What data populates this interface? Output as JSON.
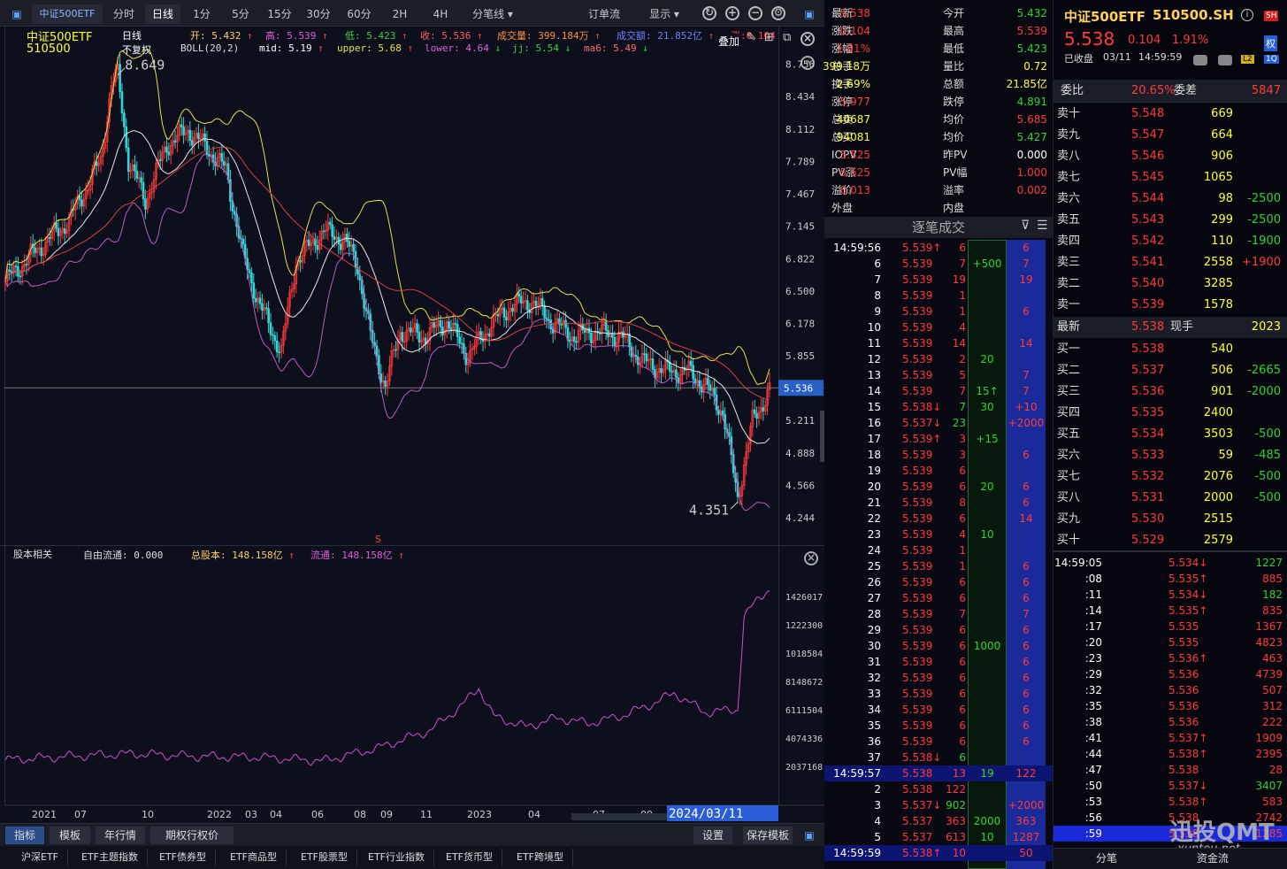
{
  "colors": {
    "up": "#ff3b3b",
    "down": "#2fd62f",
    "bg": "#0d0f1c",
    "ma_yellow": "#e5e04c",
    "ma_white": "#e8e8e8",
    "ma_red": "#d84040",
    "boll_lower": "#c05ac0"
  },
  "toolbar": {
    "security": "中证500ETF",
    "tabs": [
      "分时",
      "日线",
      "1分",
      "5分",
      "15分",
      "30分",
      "60分",
      "2H",
      "4H"
    ],
    "active_tab": "日线",
    "split": "分笔线",
    "order_flow": "订单流",
    "display": "显示"
  },
  "info_bar": {
    "name": "中证500ETF",
    "code": "510500",
    "period": "日线",
    "adjust": "不复权",
    "indicator": "BOLL(20,2)",
    "open_label": "开:",
    "open": "5.432",
    "high_label": "高:",
    "high": "5.539",
    "low_label": "低:",
    "low": "5.423",
    "close_label": "收:",
    "close": "5.536",
    "vol_label": "成交量:",
    "vol": "399.184万",
    "amt_label": "成交额:",
    "amt": "21.852亿",
    "chg_label": "涨:",
    "chg": "0.104",
    "overlay": "叠加",
    "mid_label": "mid:",
    "mid": "5.19",
    "upper_label": "upper:",
    "upper": "5.68",
    "lower_label": "lower:",
    "lower": "4.64",
    "jj_label": "jj:",
    "jj": "5.54",
    "ma6_label": "ma6:",
    "ma6": "5.49"
  },
  "chart_data": [
    {
      "type": "candlestick",
      "axis_ticks": [
        "8.756",
        "8.434",
        "8.112",
        "7.789",
        "7.467",
        "7.145",
        "6.822",
        "6.500",
        "6.178",
        "5.855",
        "5.533",
        "5.211",
        "4.888",
        "4.566",
        "4.244"
      ],
      "last_price_label": "5.536",
      "max_label": "8.649",
      "min_label": "4.351",
      "signal": "S",
      "x_labels": [
        "2021",
        "07",
        "10",
        "2022",
        "03",
        "04",
        "06",
        "08",
        "09",
        "11",
        "2023",
        "04",
        "07",
        "09"
      ],
      "cursor_date": "2024/03/11",
      "keypoints": [
        [
          0,
          6.6
        ],
        [
          12,
          6.85
        ],
        [
          30,
          7.2
        ],
        [
          45,
          7.8
        ],
        [
          50,
          8.55
        ],
        [
          53,
          8.65
        ],
        [
          58,
          7.8
        ],
        [
          66,
          7.4
        ],
        [
          76,
          7.95
        ],
        [
          86,
          8.1
        ],
        [
          96,
          7.9
        ],
        [
          104,
          7.7
        ],
        [
          112,
          6.85
        ],
        [
          120,
          6.35
        ],
        [
          130,
          5.9
        ],
        [
          137,
          6.8
        ],
        [
          150,
          7.1
        ],
        [
          160,
          7.0
        ],
        [
          166,
          6.75
        ],
        [
          172,
          6.05
        ],
        [
          179,
          5.55
        ],
        [
          186,
          6.1
        ],
        [
          198,
          6.05
        ],
        [
          208,
          6.2
        ],
        [
          218,
          5.85
        ],
        [
          228,
          6.15
        ],
        [
          238,
          6.35
        ],
        [
          248,
          6.4
        ],
        [
          258,
          6.18
        ],
        [
          268,
          6.05
        ],
        [
          278,
          6.1
        ],
        [
          290,
          6.05
        ],
        [
          300,
          5.8
        ],
        [
          312,
          5.7
        ],
        [
          322,
          5.7
        ],
        [
          330,
          5.55
        ],
        [
          338,
          5.3
        ],
        [
          345,
          4.45
        ],
        [
          352,
          5.2
        ],
        [
          360,
          5.52
        ]
      ]
    },
    {
      "type": "line",
      "section": "股本相关",
      "free_label": "自由流通:",
      "free_float": "0.000",
      "total_label": "总股本:",
      "total_shares": "148.158亿",
      "float_label": "流通:",
      "float_shares": "148.158亿",
      "axis_ticks": [
        "1426017",
        "1222300",
        "1018584",
        "8148672",
        "6111504",
        "4074336",
        "2037168"
      ],
      "keypoints": [
        [
          0,
          4550000
        ],
        [
          30,
          4750000
        ],
        [
          60,
          4900000
        ],
        [
          90,
          4750000
        ],
        [
          120,
          4700000
        ],
        [
          150,
          4500000
        ],
        [
          175,
          5200000
        ],
        [
          200,
          6200000
        ],
        [
          215,
          7600000
        ],
        [
          223,
          8600000
        ],
        [
          230,
          7000000
        ],
        [
          245,
          6400000
        ],
        [
          260,
          6900000
        ],
        [
          275,
          6600000
        ],
        [
          290,
          7000000
        ],
        [
          305,
          7700000
        ],
        [
          315,
          8300000
        ],
        [
          330,
          7200000
        ],
        [
          345,
          7400000
        ],
        [
          348,
          12500000
        ],
        [
          355,
          13700000
        ],
        [
          360,
          14100000
        ]
      ]
    }
  ],
  "bottom_tabs": [
    "指标",
    "模板",
    "年行情",
    "期权行权价",
    "设置",
    "保存模板"
  ],
  "type_tabs": [
    "沪深ETF",
    "ETF主题指数",
    "ETF债券型",
    "ETF商品型",
    "ETF股票型",
    "ETF行业指数",
    "ETF货币型",
    "ETF跨境型"
  ],
  "quote": [
    [
      "最新",
      "5.538",
      "今开",
      "5.432"
    ],
    [
      "涨跌",
      "0.104",
      "最高",
      "5.539"
    ],
    [
      "涨幅",
      "1.91%",
      "最低",
      "5.423"
    ],
    [
      "总手",
      "399.18万",
      "量比",
      "0.72"
    ],
    [
      "换手",
      "2.69%",
      "总额",
      "21.85亿"
    ],
    [
      "涨停",
      "5.977",
      "跌停",
      "4.891"
    ],
    [
      "总卖",
      "40687",
      "均价",
      "5.685"
    ],
    [
      "总买",
      "94081",
      "均价",
      "5.427"
    ],
    [
      "IOPV",
      "5.525",
      "昨PV",
      "0.000"
    ],
    [
      "PV涨",
      "5.525",
      "PV幅",
      "1.000"
    ],
    [
      "溢价",
      "0.013",
      "溢率",
      "0.002"
    ],
    [
      "外盘",
      "",
      "内盘",
      ""
    ]
  ],
  "ticks": {
    "title": "逐笔成交",
    "rows": [
      [
        "14:59:56",
        "5.539↑",
        "6"
      ],
      [
        "6",
        "5.539",
        "7"
      ],
      [
        "7",
        "5.539",
        "19"
      ],
      [
        "8",
        "5.539",
        "1"
      ],
      [
        "9",
        "5.539",
        "1"
      ],
      [
        "10",
        "5.539",
        "4"
      ],
      [
        "11",
        "5.539",
        "14"
      ],
      [
        "12",
        "5.539",
        "2"
      ],
      [
        "13",
        "5.539",
        "5"
      ],
      [
        "14",
        "5.539",
        "7"
      ],
      [
        "15",
        "5.538↓",
        "7"
      ],
      [
        "16",
        "5.537↓",
        "23"
      ],
      [
        "17",
        "5.539↑",
        "3"
      ],
      [
        "18",
        "5.539",
        "3"
      ],
      [
        "19",
        "5.539",
        "6"
      ],
      [
        "20",
        "5.539",
        "6"
      ],
      [
        "21",
        "5.539",
        "8"
      ],
      [
        "22",
        "5.539",
        "6"
      ],
      [
        "23",
        "5.539",
        "4"
      ],
      [
        "24",
        "5.539",
        "1"
      ],
      [
        "25",
        "5.539",
        "1"
      ],
      [
        "26",
        "5.539",
        "6"
      ],
      [
        "27",
        "5.539",
        "6"
      ],
      [
        "28",
        "5.539",
        "7"
      ],
      [
        "29",
        "5.539",
        "6"
      ],
      [
        "30",
        "5.539",
        "6"
      ],
      [
        "31",
        "5.539",
        "6"
      ],
      [
        "32",
        "5.539",
        "6"
      ],
      [
        "33",
        "5.539",
        "6"
      ],
      [
        "34",
        "5.539",
        "6"
      ],
      [
        "35",
        "5.539",
        "6"
      ],
      [
        "36",
        "5.539",
        "6"
      ],
      [
        "37",
        "5.538↓",
        "6"
      ],
      [
        "14:59:57",
        "5.538",
        "13"
      ],
      [
        "2",
        "5.538",
        "122"
      ],
      [
        "3",
        "5.537↓",
        "902"
      ],
      [
        "4",
        "5.537",
        "363"
      ],
      [
        "5",
        "5.537",
        "613"
      ],
      [
        "14:59:59",
        "5.538↑",
        "10"
      ]
    ],
    "col3": [
      "6",
      "7",
      "19",
      "1",
      "6",
      "20",
      "14",
      "7",
      "15",
      "7",
      "30",
      "10",
      "2000",
      "15",
      "3",
      "6",
      "20",
      "6",
      "14",
      "10",
      "6",
      "1000",
      "19",
      "122",
      "2000",
      "2000",
      "363",
      "1287",
      "10",
      "50"
    ]
  },
  "orderbook": {
    "name": "中证500ETF",
    "code": "510500.SH",
    "price": "5.538",
    "chg": "0.104",
    "pct": "1.91%",
    "status": "已收盘",
    "date": "03/11",
    "time": "14:59:59",
    "wb_label": "委比",
    "wb": "20.65%",
    "wc_label": "委差",
    "wc": "5847",
    "asks": [
      [
        "卖十",
        "5.548",
        "669",
        ""
      ],
      [
        "卖九",
        "5.547",
        "664",
        ""
      ],
      [
        "卖八",
        "5.546",
        "906",
        ""
      ],
      [
        "卖七",
        "5.545",
        "1065",
        ""
      ],
      [
        "卖六",
        "5.544",
        "98",
        "-2500"
      ],
      [
        "卖五",
        "5.543",
        "299",
        "-2500"
      ],
      [
        "卖四",
        "5.542",
        "110",
        "-1900"
      ],
      [
        "卖三",
        "5.541",
        "2558",
        "+1900"
      ],
      [
        "卖二",
        "5.540",
        "3285",
        ""
      ],
      [
        "卖一",
        "5.539",
        "1578",
        ""
      ]
    ],
    "last": [
      "最新",
      "5.538",
      "现手",
      "2023"
    ],
    "bids": [
      [
        "买一",
        "5.538",
        "540",
        ""
      ],
      [
        "买二",
        "5.537",
        "506",
        "-2665"
      ],
      [
        "买三",
        "5.536",
        "901",
        "-2000"
      ],
      [
        "买四",
        "5.535",
        "2400",
        ""
      ],
      [
        "买五",
        "5.534",
        "3503",
        "-500"
      ],
      [
        "买六",
        "5.533",
        "59",
        "-485"
      ],
      [
        "买七",
        "5.532",
        "2076",
        "-500"
      ],
      [
        "买八",
        "5.531",
        "2000",
        "-500"
      ],
      [
        "买九",
        "5.530",
        "2515",
        ""
      ],
      [
        "买十",
        "5.529",
        "2579",
        ""
      ]
    ],
    "minute": [
      [
        "14:59:05",
        "5.534↓",
        "1227"
      ],
      [
        ":08",
        "5.535↑",
        "885"
      ],
      [
        ":11",
        "5.534↓",
        "182"
      ],
      [
        ":14",
        "5.535↑",
        "835"
      ],
      [
        ":17",
        "5.535",
        "1367"
      ],
      [
        ":20",
        "5.535",
        "4823"
      ],
      [
        ":23",
        "5.536↑",
        "463"
      ],
      [
        ":29",
        "5.536",
        "4739"
      ],
      [
        ":32",
        "5.536",
        "507"
      ],
      [
        ":35",
        "5.536",
        "312"
      ],
      [
        ":38",
        "5.536",
        "222"
      ],
      [
        ":41",
        "5.537↑",
        "1909"
      ],
      [
        ":44",
        "5.538↑",
        "2395"
      ],
      [
        ":47",
        "5.538",
        "28"
      ],
      [
        ":50",
        "5.537↓",
        "3407"
      ],
      [
        ":53",
        "5.538↑",
        "583"
      ],
      [
        ":56",
        "5.538",
        "2742"
      ],
      [
        ":59",
        "5.538",
        "1285"
      ]
    ],
    "bottom_tabs": [
      "分笔",
      "资金流"
    ],
    "watermark": "迅投QMT",
    "watermark_url": "xuntou.net"
  }
}
